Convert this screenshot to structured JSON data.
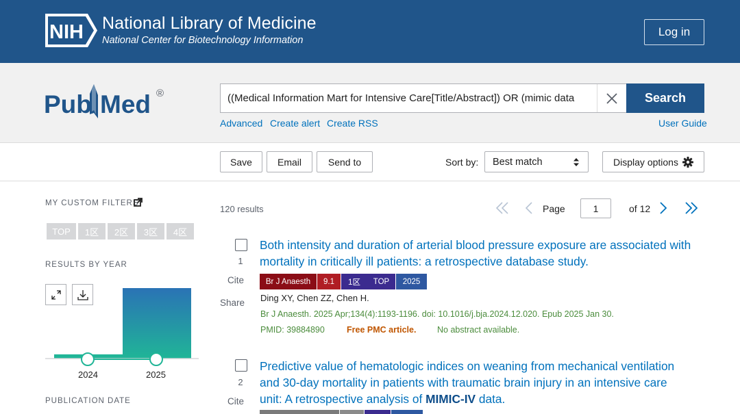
{
  "nih": {
    "logo_text": "NIH",
    "title": "National Library of Medicine",
    "subtitle": "National Center for Biotechnology Information",
    "login_label": "Log in"
  },
  "pubmed": {
    "logo_text_left": "Pub",
    "logo_text_right": "Med",
    "registered": "®"
  },
  "search": {
    "query": "((Medical Information Mart for Intensive Care[Title/Abstract]) OR (mimic data",
    "button_label": "Search",
    "links": {
      "advanced": "Advanced",
      "create_alert": "Create alert",
      "create_rss": "Create RSS",
      "user_guide": "User Guide"
    }
  },
  "toolbar": {
    "save": "Save",
    "email": "Email",
    "send_to": "Send to",
    "sort_label": "Sort by:",
    "sort_value": "Best match",
    "display_options": "Display options"
  },
  "sidebar": {
    "custom_filters_heading": "MY CUSTOM FILTERS",
    "filters": [
      "TOP",
      "1区",
      "2区",
      "3区",
      "4区"
    ],
    "results_by_year_heading": "RESULTS BY YEAR",
    "years": [
      {
        "label": "2024",
        "count_fraction": 0.06
      },
      {
        "label": "2025",
        "count_fraction": 1.0
      }
    ],
    "publication_date_heading": "PUBLICATION DATE"
  },
  "results_header": {
    "count_text": "120 results",
    "page_label": "Page",
    "page_value": "1",
    "of_pages": "of 12"
  },
  "colors": {
    "nih_blue": "#20558a",
    "link_blue": "#0071bc",
    "journal_badge": "#8b0d16",
    "impact_badge": "#b01d24",
    "quartile_badge": "#3b2b8f",
    "year_badge": "#2e58a1",
    "chart_teal": "#20b597"
  },
  "results": [
    {
      "number": "1",
      "cite": "Cite",
      "share": "Share",
      "title": "Both intensity and duration of arterial blood pressure exposure are associated with mortality in critically ill patients: a retrospective database study.",
      "badges": {
        "journal": "Br J Anaesth",
        "impact": "9.1",
        "zone": "1区",
        "top": "TOP",
        "year": "2025"
      },
      "authors": "Ding XY, Chen ZZ, Chen H.",
      "citation": "Br J Anaesth. 2025 Apr;134(4):1193-1196. doi: 10.1016/j.bja.2024.12.020. Epub 2025 Jan 30.",
      "pmid": "PMID: 39884890",
      "free_pmc": "Free PMC article.",
      "abstract_note": "No abstract available."
    },
    {
      "number": "2",
      "cite": "Cite",
      "title_part1": "Predictive value of hematologic indices on weaning from mechanical ventilation and 30-day mortality in patients with traumatic brain injury in an intensive care unit: A retrospective analysis of ",
      "title_highlight": "MIMIC-IV",
      "title_part2": " data."
    }
  ]
}
